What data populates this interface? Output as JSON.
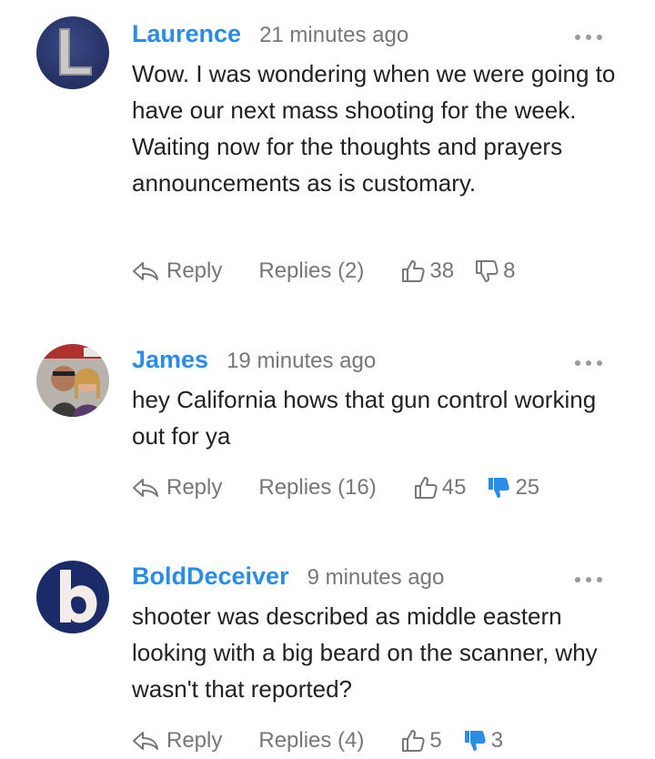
{
  "comments": [
    {
      "author": "Laurence",
      "time": "21 minutes ago",
      "text": "Wow. I was wondering when we were going to have our next mass shooting for the week. Waiting now for the thoughts and prayers announcements as is customary.",
      "reply_label": "Reply",
      "replies_label": "Replies (2)",
      "upvotes": "38",
      "downvotes": "8",
      "downvoted": false,
      "avatar": "letter-L-avatar"
    },
    {
      "author": "James",
      "time": "19 minutes ago",
      "text": "hey California hows that gun control working out for ya",
      "reply_label": "Reply",
      "replies_label": "Replies (16)",
      "upvotes": "45",
      "downvotes": "25",
      "downvoted": true,
      "avatar": "photo-avatar"
    },
    {
      "author": "BoldDeceiver",
      "time": "9 minutes ago",
      "text": "shooter was described as middle eastern looking with a big beard on the scanner, why wasn't that reported?",
      "reply_label": "Reply",
      "replies_label": "Replies (4)",
      "upvotes": "5",
      "downvotes": "3",
      "downvoted": true,
      "avatar": "letter-b-avatar"
    }
  ],
  "colors": {
    "author": "#2b8ce6",
    "meta": "#777777",
    "text": "#222222",
    "downvote_active": "#2b8ce6"
  }
}
